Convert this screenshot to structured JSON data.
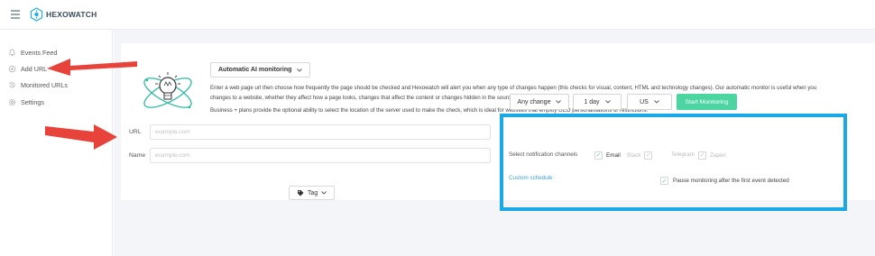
{
  "header": {
    "brand": "HEXOWATCH"
  },
  "sidebar": {
    "items": [
      {
        "label": "Events Feed",
        "icon": "bell-icon"
      },
      {
        "label": "Add URL",
        "icon": "plus-circle-icon"
      },
      {
        "label": "Monitored URLs",
        "icon": "history-icon"
      },
      {
        "label": "Settings",
        "icon": "gear-icon"
      }
    ]
  },
  "main": {
    "mode_label": "Automatic AI monitoring",
    "description_line1": "Enter a web page url then choose how frequently the page should be checked and Hexowatch will alert you when any type of changes happen (this checks for visual, content, HTML and technology changes). Our automatic monitor is useful when you",
    "description_line2": "changes to a website, whether they affect how a page looks, changes that affect the content or changes hidden in the source code.",
    "description_line3": "Business + plans provide the optional ability to select the location of the server used to make the check, which is ideal for websites that employ GEO personalisations or restrictions.",
    "url_label": "URL",
    "url_placeholder": "example.com",
    "name_label": "Name",
    "name_placeholder": "example.com",
    "tag_label": "Tag"
  },
  "settings": {
    "change_type": "Any change",
    "frequency": "1 day",
    "location": "US",
    "start_label": "Start Monitoring",
    "notif_label": "Select notification channels",
    "channels": [
      {
        "label": "Email",
        "checked": true
      },
      {
        "label": "Slack",
        "checked": false
      },
      {
        "label": "Telegram",
        "checked": false
      },
      {
        "label": "Zapier",
        "checked": false
      }
    ],
    "custom_schedule": "Custom schedule",
    "pause_label": "Pause monitoring after the first event detected"
  },
  "colors": {
    "accent_green": "#4cd5a0",
    "link_blue": "#3ba0d8",
    "highlight_blue": "#1aa9e6",
    "arrow_red": "#e8433b"
  }
}
